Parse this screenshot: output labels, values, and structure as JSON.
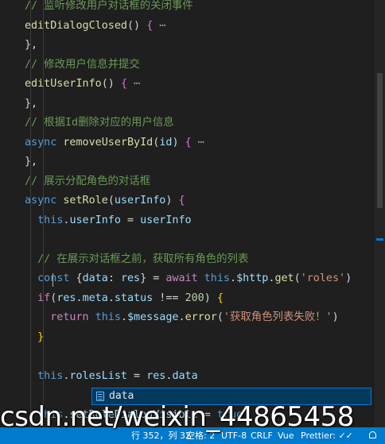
{
  "editor": {
    "lines": [
      [
        {
          "t": "// 监听修改用户对话框的关闭事件",
          "c": "comment"
        }
      ],
      [
        {
          "t": "editDialogClosed",
          "c": "method"
        },
        {
          "t": "() ",
          "c": "punc"
        },
        {
          "t": "{",
          "c": "bracket2"
        },
        {
          "t": " ⋯",
          "c": "fold"
        }
      ],
      [
        {
          "t": "},",
          "c": "punc"
        }
      ],
      [
        {
          "t": "// 修改用户信息并提交",
          "c": "comment"
        }
      ],
      [
        {
          "t": "editUserInfo",
          "c": "method"
        },
        {
          "t": "() ",
          "c": "punc"
        },
        {
          "t": "{",
          "c": "bracket2"
        },
        {
          "t": " ⋯",
          "c": "fold"
        }
      ],
      [
        {
          "t": "},",
          "c": "punc"
        }
      ],
      [
        {
          "t": "// 根据Id删除对应的用户信息",
          "c": "comment"
        }
      ],
      [
        {
          "t": "async ",
          "c": "keyword"
        },
        {
          "t": "removeUserById",
          "c": "method"
        },
        {
          "t": "(",
          "c": "punc"
        },
        {
          "t": "id",
          "c": "var"
        },
        {
          "t": ") ",
          "c": "punc"
        },
        {
          "t": "{",
          "c": "bracket2"
        },
        {
          "t": " ⋯",
          "c": "fold"
        }
      ],
      [
        {
          "t": "},",
          "c": "punc"
        }
      ],
      [
        {
          "t": "// 展示分配角色的对话框",
          "c": "comment"
        }
      ],
      [
        {
          "t": "async ",
          "c": "keyword"
        },
        {
          "t": "setRole",
          "c": "method"
        },
        {
          "t": "(",
          "c": "punc"
        },
        {
          "t": "userInfo",
          "c": "var"
        },
        {
          "t": ") ",
          "c": "punc"
        },
        {
          "t": "{",
          "c": "bracket2"
        }
      ],
      [
        {
          "t": "  ",
          "c": "punc"
        },
        {
          "t": "this",
          "c": "this"
        },
        {
          "t": ".",
          "c": "punc"
        },
        {
          "t": "userInfo",
          "c": "prop"
        },
        {
          "t": " = ",
          "c": "punc"
        },
        {
          "t": "userInfo",
          "c": "var"
        }
      ],
      [],
      [
        {
          "t": "  ",
          "c": "punc"
        },
        {
          "t": "// 在展示对话框之前，获取所有角色的列表",
          "c": "comment"
        }
      ],
      [
        {
          "t": "  ",
          "c": "punc"
        },
        {
          "t": "const ",
          "c": "keyword"
        },
        {
          "t": "{",
          "c": "punc"
        },
        {
          "t": "data",
          "c": "prop"
        },
        {
          "t": ": ",
          "c": "punc"
        },
        {
          "t": "res",
          "c": "var"
        },
        {
          "t": "}",
          "c": "punc"
        },
        {
          "t": " = ",
          "c": "punc"
        },
        {
          "t": "await ",
          "c": "control"
        },
        {
          "t": "this",
          "c": "this"
        },
        {
          "t": ".",
          "c": "punc"
        },
        {
          "t": "$http",
          "c": "prop"
        },
        {
          "t": ".",
          "c": "punc"
        },
        {
          "t": "get",
          "c": "method"
        },
        {
          "t": "(",
          "c": "punc"
        },
        {
          "t": "'roles'",
          "c": "string"
        },
        {
          "t": ")",
          "c": "punc"
        }
      ],
      [
        {
          "t": "  ",
          "c": "punc"
        },
        {
          "t": "if",
          "c": "control"
        },
        {
          "t": "(",
          "c": "punc"
        },
        {
          "t": "res",
          "c": "var"
        },
        {
          "t": ".",
          "c": "punc"
        },
        {
          "t": "meta",
          "c": "prop"
        },
        {
          "t": ".",
          "c": "punc"
        },
        {
          "t": "status",
          "c": "prop"
        },
        {
          "t": " !== ",
          "c": "punc"
        },
        {
          "t": "200",
          "c": "number"
        },
        {
          "t": ") ",
          "c": "punc"
        },
        {
          "t": "{",
          "c": "bracket"
        }
      ],
      [
        {
          "t": "    ",
          "c": "punc"
        },
        {
          "t": "return ",
          "c": "control"
        },
        {
          "t": "this",
          "c": "this"
        },
        {
          "t": ".",
          "c": "punc"
        },
        {
          "t": "$message",
          "c": "prop"
        },
        {
          "t": ".",
          "c": "punc"
        },
        {
          "t": "error",
          "c": "method"
        },
        {
          "t": "(",
          "c": "punc"
        },
        {
          "t": "'获取角色列表失败！'",
          "c": "string"
        },
        {
          "t": ")",
          "c": "punc"
        }
      ],
      [
        {
          "t": "  ",
          "c": "punc"
        },
        {
          "t": "}",
          "c": "bracket"
        }
      ],
      [],
      [
        {
          "t": "  ",
          "c": "punc"
        },
        {
          "t": "this",
          "c": "this"
        },
        {
          "t": ".",
          "c": "punc"
        },
        {
          "t": "rolesList",
          "c": "prop"
        },
        {
          "t": " = ",
          "c": "punc"
        },
        {
          "t": "res",
          "c": "var"
        },
        {
          "t": ".",
          "c": "punc"
        },
        {
          "t": "data",
          "c": "prop"
        }
      ],
      [],
      [
        {
          "t": "  ",
          "c": "punc"
        },
        {
          "t": "this",
          "c": "this"
        },
        {
          "t": ".",
          "c": "punc"
        },
        {
          "t": "setRoleDialogVisible",
          "c": "prop"
        },
        {
          "t": " = ",
          "c": "punc"
        },
        {
          "t": "true",
          "c": "keyword"
        }
      ]
    ]
  },
  "suggest": {
    "items": [
      {
        "label": "data",
        "match": "data",
        "kind": "property-icon"
      }
    ]
  },
  "statusbar": {
    "position": "行 352，列 32",
    "spaces": "空格: 2",
    "encoding": "UTF-8",
    "eol": "CRLF",
    "language": "Vue",
    "formatter": "Prettier: ✓✓"
  },
  "watermark": {
    "text": "csdn.net/weixin_44865458"
  },
  "colors": {
    "background": "#1f1f1f",
    "statusbar": "#007acc",
    "comment": "#6a9955",
    "function": "#dcdcaa",
    "keyword": "#569cd6",
    "variable": "#9cdcfe",
    "string": "#ce9178"
  }
}
